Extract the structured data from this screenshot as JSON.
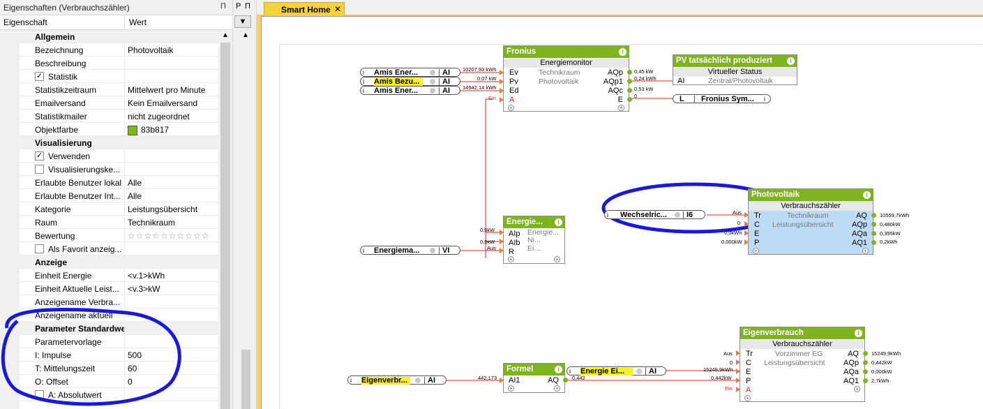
{
  "properties": {
    "title": "Eigenschaften (Verbrauchszähler)",
    "pin_label": "Π",
    "col_name": "Eigenschaft",
    "col_value": "Wert",
    "rows": [
      {
        "kind": "cat",
        "name": "Allgemein",
        "toggle": "⊟"
      },
      {
        "kind": "prop",
        "name": "Bezeichnung",
        "value": "Photovoltaik"
      },
      {
        "kind": "prop",
        "name": "Beschreibung",
        "value": ""
      },
      {
        "kind": "check",
        "name": "Statistik",
        "checked": true
      },
      {
        "kind": "prop",
        "name": "Statistikzeitraum",
        "value": "Mittelwert pro Minute"
      },
      {
        "kind": "prop",
        "name": "Emailversand",
        "value": "Kein Emailversand"
      },
      {
        "kind": "prop",
        "name": "Statistikmailer",
        "value": "nicht zugeordnet"
      },
      {
        "kind": "color",
        "name": "Objektfarbe",
        "value": "83b817",
        "color": "#83b817"
      },
      {
        "kind": "cat",
        "name": "Visualisierung",
        "toggle": "⊟"
      },
      {
        "kind": "check",
        "name": "Verwenden",
        "checked": true
      },
      {
        "kind": "check",
        "name": "Visualisierungske...",
        "checked": false
      },
      {
        "kind": "prop",
        "name": "Erlaubte Benutzer lokal",
        "value": "Alle"
      },
      {
        "kind": "prop",
        "name": "Erlaubte Benutzer Int...",
        "value": "Alle"
      },
      {
        "kind": "prop",
        "name": "Kategorie",
        "value": "Leistungsübersicht"
      },
      {
        "kind": "prop",
        "name": "Raum",
        "value": "Technikraum"
      },
      {
        "kind": "prop",
        "name": "Bewertung",
        "value": "☆☆☆☆☆☆☆☆☆☆"
      },
      {
        "kind": "check",
        "name": "Als Favorit anzeig...",
        "checked": false
      },
      {
        "kind": "cat",
        "name": "Anzeige",
        "toggle": "⊟"
      },
      {
        "kind": "prop",
        "name": "Einheit Energie",
        "value": "<v.1>kWh"
      },
      {
        "kind": "prop",
        "name": "Einheit Aktuelle Leist...",
        "value": "<v.3>kW"
      },
      {
        "kind": "prop",
        "name": "Anzeigename Verbra...",
        "value": ""
      },
      {
        "kind": "prop",
        "name": "Anzeigename aktuell",
        "value": ""
      },
      {
        "kind": "cat",
        "name": "Parameter Standardwert",
        "toggle": "⊟"
      },
      {
        "kind": "prop",
        "name": "Parametervorlage",
        "value": ""
      },
      {
        "kind": "prop",
        "name": "I: Impulse",
        "value": "500"
      },
      {
        "kind": "prop",
        "name": "T: Mittelungszeit",
        "value": "60"
      },
      {
        "kind": "prop",
        "name": "O: Offset",
        "value": "0"
      },
      {
        "kind": "check",
        "name": "A: Absolutwert",
        "checked": false
      }
    ]
  },
  "middle": {
    "p1": "P",
    "p2": "Π",
    "filter_icon": "funnel-icon"
  },
  "tab": {
    "label": "Smart Home",
    "close": "✕"
  },
  "blocks": {
    "fronius": {
      "title": "Fronius",
      "sub": "Energiemonitor",
      "gray1": "Technikraum",
      "gray2": "Photovoltaik",
      "inputs": [
        "Ev",
        "Pv",
        "Ed",
        "A"
      ],
      "outputs": [
        "AQp",
        "AQp1",
        "AQc",
        "E"
      ]
    },
    "pv_prod": {
      "title": "PV tatsächlich produziert",
      "sub": "Virtueller Status",
      "in": "AI",
      "gray": "Zentral/Photovoltaik"
    },
    "energie_small": {
      "title": "Energie...",
      "inputs": [
        "AIp",
        "AIb",
        "R"
      ],
      "gray1": "Energie...",
      "gray2": "Ni...",
      "gray3": "Ei..."
    },
    "photovoltaik": {
      "title": "Photovoltaik",
      "sub": "Verbrauchszähler",
      "gray1": "Technikraum",
      "gray2": "Leistungsübersicht",
      "inputs": [
        "Tr",
        "C",
        "E",
        "P"
      ],
      "outputs": [
        "AQ",
        "AQp",
        "AQa",
        "AQ1"
      ]
    },
    "eigenverbrauch": {
      "title": "Eigenverbrauch",
      "sub": "Verbrauchszähler",
      "gray1": "Vorzimmer EG",
      "gray2": "Leistungsübersicht",
      "inputs": [
        "Tr",
        "C",
        "E",
        "P",
        "A"
      ],
      "outputs": [
        "AQ",
        "AQp",
        "AQa",
        "AQ1"
      ]
    },
    "formel": {
      "title": "Formel",
      "input": "AI1",
      "output": "AQ"
    }
  },
  "refs": {
    "amis1": {
      "name": "Amis Ener...",
      "type": "AI"
    },
    "amis2": {
      "name": "Amis Bezu...",
      "type": "AI"
    },
    "amis3": {
      "name": "Amis Ener...",
      "type": "AI"
    },
    "energiema": {
      "name": "Energiema...",
      "type": "VI"
    },
    "fronius_sym": {
      "name": "Fronius Sym...",
      "type": "L"
    },
    "wechsel": {
      "name": "Wechselric...",
      "type": "I6"
    },
    "eigenverbr": {
      "name": "Eigenverbr...",
      "type": "AI"
    },
    "energie_ei": {
      "name": "Energie Ei...",
      "type": "AI"
    }
  },
  "values": {
    "fronius_in": [
      "10207,93 kWh",
      "0,07 kW",
      "14942,14 kWh",
      "Ein"
    ],
    "fronius_out": [
      "0,45 kW",
      "0,24 kWh",
      "0,53 kW",
      "0"
    ],
    "energie_in": [
      "0,0kW",
      "0,0kW",
      "Aus"
    ],
    "pv_in": [
      "Aus",
      "0",
      "0,0kWh",
      "0,000kW"
    ],
    "pv_out": [
      "10559,7kWh",
      "0,480kW",
      "0,395kW",
      "0,2kWh"
    ],
    "formel_in": "442,173",
    "formel_out": "0,442",
    "eig_in": [
      "Aus",
      "0",
      "15249,9kWh",
      "0,442kW",
      "Ein"
    ],
    "eig_out": [
      "15249,9kWh",
      "0,442kW",
      "0,000kW",
      "2,7kWh"
    ]
  },
  "colors": {
    "block_header": "#7fb31f",
    "highlight": "#f8ef2a",
    "selection": "#bfdcf7",
    "annotation": "#1a1ad6",
    "tab": "#f5d040"
  }
}
